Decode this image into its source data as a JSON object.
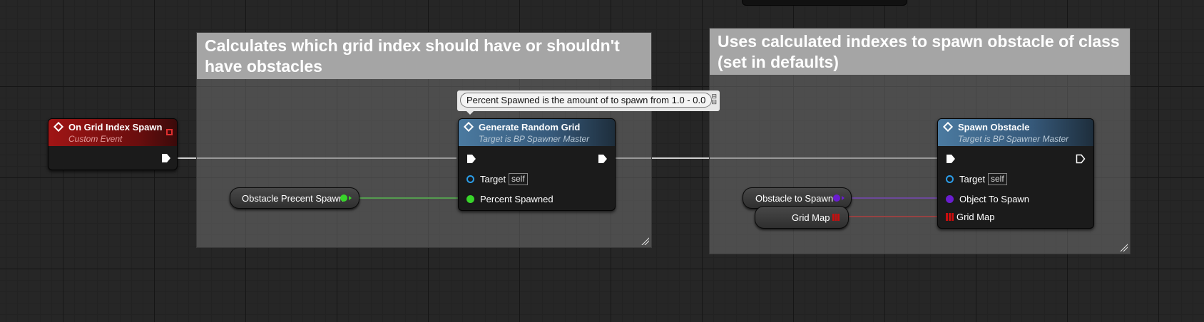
{
  "comments": [
    {
      "id": "c1",
      "text": "Calculates which grid index should have or shouldn't have obstacles"
    },
    {
      "id": "c2",
      "text": "Uses calculated indexes to spawn obstacle of class (set in defaults)"
    }
  ],
  "tooltip": {
    "text": "Percent Spawned is the amount of to spawn from 1.0 - 0.0"
  },
  "event_node": {
    "title": "On Grid Index Spawn",
    "subtitle": "Custom Event"
  },
  "generate_node": {
    "title": "Generate Random Grid",
    "subtitle": "Target is BP Spawner Master",
    "target_label": "Target",
    "self_label": "self",
    "percent_label": "Percent Spawned"
  },
  "spawn_node": {
    "title": "Spawn Obstacle",
    "subtitle": "Target is BP Spawner Master",
    "target_label": "Target",
    "self_label": "self",
    "object_label": "Object To Spawn",
    "gridmap_label": "Grid Map"
  },
  "variables": {
    "obstacle_percent": "Obstacle Precent Spawn",
    "obstacle_to_spawn": "Obstacle to Spawn",
    "grid_map": "Grid Map"
  },
  "colors": {
    "exec": "#ffffff",
    "float": "#38d52a",
    "object": "#6a1dd0",
    "map": "#c80e0e",
    "target": "#2b9de9",
    "event_header": "#a01515",
    "function_header": "#4b7aa0"
  }
}
